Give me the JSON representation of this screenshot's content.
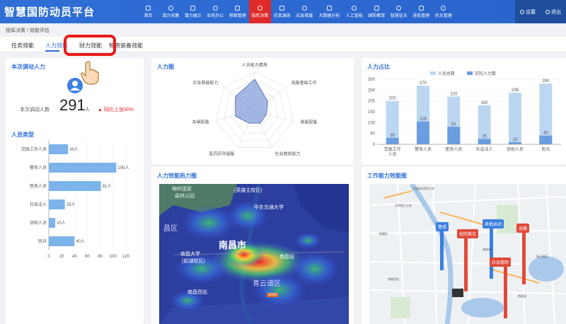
{
  "app": {
    "title": "智慧国防动员平台"
  },
  "nav": {
    "items": [
      "首页",
      "潜力采集",
      "潜力展示",
      "业务办公",
      "预案管理",
      "指挥决策",
      "仿真演练",
      "应急救援",
      "大数据分析",
      "人工智能",
      "国防教育",
      "智慧征兵",
      "进役管理",
      "民兵管理"
    ],
    "active_index": 5,
    "settings_label": "设置",
    "exit_label": "退出"
  },
  "breadcrumb": {
    "parent": "指挥决策",
    "separator": "/",
    "current": "效能评估"
  },
  "tabs": [
    "任务效能",
    "人力效能",
    "财力效能",
    "物资装备效能"
  ],
  "tabs_active_index": 1,
  "tabs_highlight_index": 2,
  "dispatch": {
    "title": "本次调动人力",
    "count_label": "本次调动人数",
    "count": "291",
    "unit": "人",
    "trend_arrow": "▲",
    "trend": "同比上涨30%"
  },
  "personnel_type": {
    "title": "人员类型",
    "chart_data": {
      "type": "bar",
      "orientation": "horizontal",
      "categories": [
        "党政工作人员",
        "警务人员",
        "医务人员",
        "社会法人",
        "协助人员",
        "民兵"
      ],
      "values": [
        30,
        105,
        81,
        25,
        10,
        40
      ],
      "value_labels": [
        "30人",
        "105人",
        "81人",
        "25人",
        "10人",
        "40人"
      ],
      "xlim": [
        0,
        120
      ],
      "x_ticks": [
        "0",
        "20",
        "40",
        "60",
        "80",
        "100",
        "120"
      ],
      "color": "#7cb3ea"
    }
  },
  "radar": {
    "title": "人力图",
    "chart_data": {
      "type": "radar",
      "axes": [
        "人员能力素质",
        "战备基础工作",
        "装备配备",
        "社会救助能力",
        "医药药剂储备",
        "车辆配备",
        "应急救援能力"
      ],
      "values": [
        0.82,
        0.42,
        0.3,
        0.32,
        0.32,
        0.5,
        0.62
      ],
      "color": "#5b7ed0"
    }
  },
  "ratio": {
    "title": "人力占比",
    "chart_data": {
      "type": "bar",
      "categories": [
        "党政工作人员",
        "警务人员",
        "医务人员",
        "社会法人",
        "协助人员",
        "民兵"
      ],
      "category_labels": [
        [
          "党政工作",
          "人员"
        ],
        [
          "警务人员"
        ],
        [
          "医务人员"
        ],
        [
          "社会法人"
        ],
        [
          "协助人员"
        ],
        [
          "民兵"
        ]
      ],
      "series": [
        {
          "name": "人员总数",
          "values": [
            200,
            270,
            220,
            180,
            238,
            280
          ],
          "color": "#bcd6f2"
        },
        {
          "name": "实际人力数",
          "values": [
            30,
            105,
            81,
            25,
            10,
            40
          ],
          "color": "#6a9ee0"
        }
      ],
      "stacking": "overlay",
      "ylim": [
        0,
        300
      ],
      "y_ticks": [
        "0",
        "50",
        "100",
        "150",
        "200",
        "250",
        "300"
      ],
      "legend": "top"
    }
  },
  "heatmap": {
    "title": "人力效能热力图",
    "labels": {
      "park": "梅岭国家",
      "park2": "森林公园",
      "station": "华东交通大学",
      "county": "(英雄主校区)",
      "area_nw": "昌区",
      "university": "南昌大学",
      "university2": "(前湖校区)",
      "city": "南昌市",
      "station2": "南昌站",
      "area_se": "青云谱区",
      "west_station": "南昌西站",
      "road": "G105"
    }
  },
  "work_map": {
    "title": "工作能力效能图",
    "flags": [
      {
        "label": "警戒",
        "color": "#3b7fe0"
      },
      {
        "label": "抢险救灾",
        "color": "#e04a3a"
      },
      {
        "label": "其他出动",
        "color": "#3b7fe0"
      },
      {
        "label": "运输",
        "color": "#e04a3a"
      },
      {
        "label": "社会救助",
        "color": "#e04a3a"
      }
    ],
    "place_labels": [
      "江西科技师范大学",
      "南昌站",
      "青山湖区",
      "东华理工大学",
      "新建区",
      "南昌县",
      "南昌西站"
    ]
  }
}
